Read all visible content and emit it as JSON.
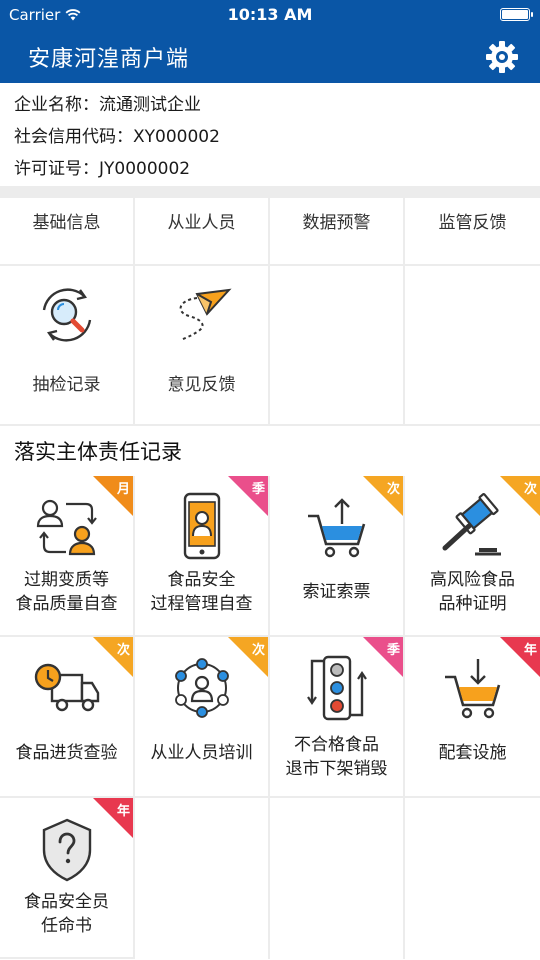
{
  "status_bar": {
    "carrier": "Carrier",
    "time": "10:13 AM"
  },
  "header": {
    "title": "安康河湟商户端",
    "settings_icon": "gear-icon"
  },
  "company": {
    "name_line": "企业名称：流通测试企业",
    "credit_line": "社会信用代码：XY000002",
    "license_line": "许可证号：JY0000002"
  },
  "tabs": [
    {
      "label": "基础信息"
    },
    {
      "label": "从业人员"
    },
    {
      "label": "数据预警"
    },
    {
      "label": "监管反馈"
    }
  ],
  "tools": [
    {
      "label": "抽检记录",
      "icon": "magnifier-refresh-icon"
    },
    {
      "label": "意见反馈",
      "icon": "paper-plane-icon"
    }
  ],
  "section": {
    "title": "落实主体责任记录"
  },
  "records": [
    {
      "label": "过期变质等\n食品质量自查",
      "badge": "月",
      "badge_color": "#f08c1a",
      "icon": "people-exchange-icon"
    },
    {
      "label": "食品安全\n过程管理自查",
      "badge": "季",
      "badge_color": "#ea4f8b",
      "icon": "phone-person-icon"
    },
    {
      "label": "索证索票",
      "badge": "次",
      "badge_color": "#f5a623",
      "icon": "cart-upload-icon"
    },
    {
      "label": "高风险食品\n品种证明",
      "badge": "次",
      "badge_color": "#f5a623",
      "icon": "gavel-icon"
    },
    {
      "label": "食品进货查验",
      "badge": "次",
      "badge_color": "#f5a623",
      "icon": "delivery-truck-icon"
    },
    {
      "label": "从业人员培训",
      "badge": "次",
      "badge_color": "#f5a623",
      "icon": "network-people-icon"
    },
    {
      "label": "不合格食品\n退市下架销毁",
      "badge": "季",
      "badge_color": "#ea4f8b",
      "icon": "traffic-flow-icon"
    },
    {
      "label": "配套设施",
      "badge": "年",
      "badge_color": "#e8384f",
      "icon": "cart-download-icon"
    },
    {
      "label": "食品安全员\n任命书",
      "badge": "年",
      "badge_color": "#e8384f",
      "icon": "shield-question-icon"
    }
  ],
  "colors": {
    "primary": "#0a56a6",
    "blue": "#2b8fe0",
    "orange": "#f7a11d",
    "red": "#e34a33"
  }
}
